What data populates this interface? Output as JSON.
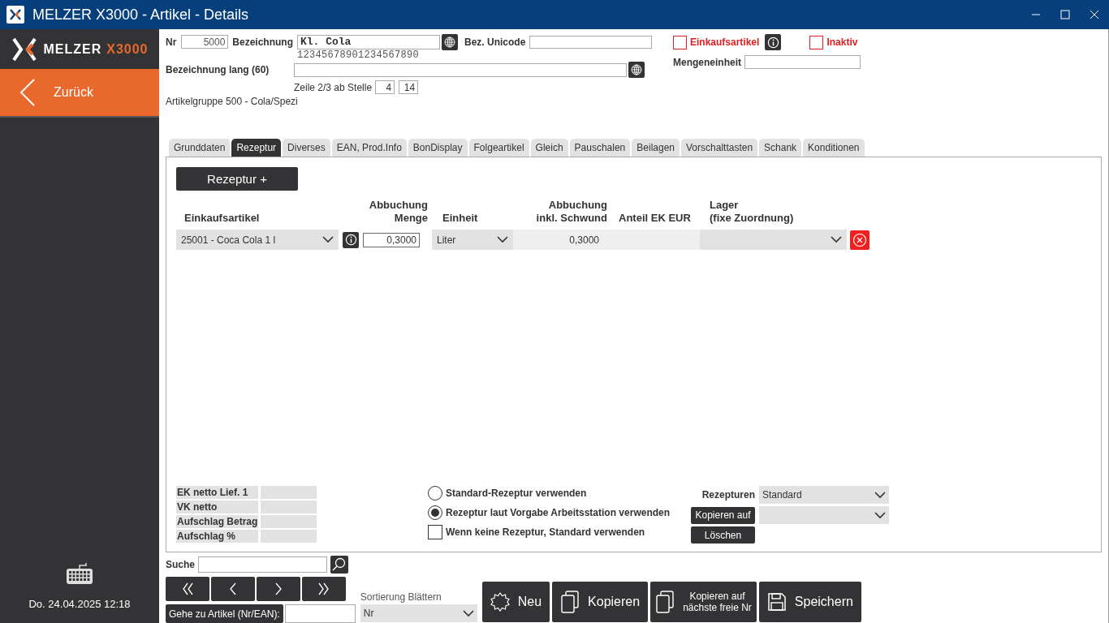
{
  "window": {
    "title": "MELZER X3000 - Artikel - Details"
  },
  "sidebar": {
    "logo_text": "MELZER",
    "logo_accent": "X3000",
    "back_button": "Zurück",
    "datetime": "Do. 24.04.2025 12:18"
  },
  "header": {
    "nr": {
      "label": "Nr",
      "value": "5000"
    },
    "bezeichnung": {
      "label": "Bezeichnung",
      "value": "Kl. Cola",
      "ruler": "12345678901234567890"
    },
    "bez_unicode": {
      "label": "Bez. Unicode"
    },
    "einkaufsartikel": {
      "label": "Einkaufsartikel",
      "checked": false
    },
    "inaktiv": {
      "label": "Inaktiv",
      "checked": false
    },
    "bezeichnung_lang": {
      "label": "Bezeichnung lang (60)"
    },
    "mengeneinheit": {
      "label": "Mengeneinheit"
    },
    "zeile": {
      "label": "Zeile 2/3 ab Stelle",
      "value_1": "4",
      "value_2": "14"
    },
    "artikelgruppe": "Artikelgruppe 500 - Cola/Spezi"
  },
  "tabs": [
    {
      "label": "Grunddaten",
      "selected": false
    },
    {
      "label": "Rezeptur",
      "selected": true
    },
    {
      "label": "Diverses",
      "selected": false
    },
    {
      "label": "EAN, Prod.Info",
      "selected": false
    },
    {
      "label": "BonDisplay",
      "selected": false
    },
    {
      "label": "Folgeartikel",
      "selected": false
    },
    {
      "label": "Gleich",
      "selected": false
    },
    {
      "label": "Pauschalen",
      "selected": false
    },
    {
      "label": "Beilagen",
      "selected": false
    },
    {
      "label": "Vorschalttasten",
      "selected": false
    },
    {
      "label": "Schank",
      "selected": false
    },
    {
      "label": "Konditionen",
      "selected": false
    }
  ],
  "recipe": {
    "add_button": "Rezeptur +",
    "columns": [
      "Einkaufsartikel",
      "Abbuchung\nMenge",
      "Einheit",
      "Abbuchung\ninkl. Schwund",
      "Anteil EK EUR",
      "Lager\n(fixe Zuordnung)"
    ],
    "rows": [
      {
        "article": "25001 - Coca Cola 1 l",
        "amount": "0,3000",
        "unit": "Liter",
        "amount_incl_loss": "0,3000"
      }
    ],
    "summary": [
      {
        "label": "EK netto Lief. 1"
      },
      {
        "label": "VK netto"
      },
      {
        "label": "Aufschlag Betrag"
      },
      {
        "label": "Aufschlag %"
      }
    ],
    "options": [
      {
        "kind": "radio",
        "label": "Standard-Rezeptur verwenden",
        "selected": false
      },
      {
        "kind": "radio",
        "label": "Rezeptur laut Vorgabe Arbeitsstation verwenden",
        "selected": true
      },
      {
        "kind": "checkbox",
        "label": "Wenn keine Rezeptur, Standard verwenden",
        "checked": false
      }
    ],
    "rezepturen": {
      "label": "Rezepturen",
      "value": "Standard",
      "copy_button": "Kopieren auf",
      "delete_button": "Löschen"
    }
  },
  "footer": {
    "search_label": "Suche",
    "goto_button": "Gehe zu Artikel (Nr/EAN):",
    "sort_label": "Sortierung Blättern",
    "sort_value": "Nr",
    "actions": [
      {
        "kind": "new",
        "label": "Neu"
      },
      {
        "kind": "copy",
        "label": "Kopieren"
      },
      {
        "kind": "copy_small",
        "label": "Kopieren auf\nnächste freie Nr"
      },
      {
        "kind": "save",
        "label": "Speichern"
      }
    ]
  }
}
